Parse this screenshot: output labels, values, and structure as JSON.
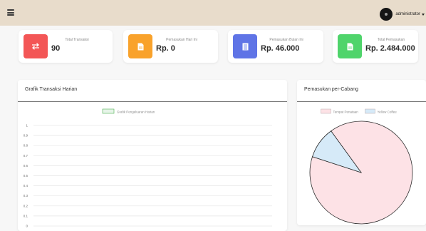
{
  "topbar": {
    "user_name": "administrator"
  },
  "cards": [
    {
      "label": "Total Transaksi",
      "value": "90",
      "icon": "exchange-arrows-icon",
      "color": "#f35656"
    },
    {
      "label": "Pemasukan Hari Ini",
      "value": "Rp. 0",
      "icon": "document-icon",
      "color": "#f9a22b"
    },
    {
      "label": "Pemasukan Bulan Ini",
      "value": "Rp. 46.000",
      "icon": "list-icon",
      "color": "#5f74e6"
    },
    {
      "label": "Total Pemasukan",
      "value": "Rp. 2.484.000",
      "icon": "document-icon",
      "color": "#4fd46b"
    }
  ],
  "panels": {
    "daily": {
      "title": "Grafik Transaksi Harian"
    },
    "branch": {
      "title": "Pemasukan per-Cabang"
    }
  },
  "chart_data": [
    {
      "type": "line",
      "title": "",
      "xlabel": "",
      "ylabel": "",
      "ylim": [
        0,
        1
      ],
      "yticks": [
        "1",
        "0.9",
        "0.8",
        "0.7",
        "0.6",
        "0.5",
        "0.4",
        "0.3",
        "0.2",
        "0.1",
        "0"
      ],
      "grid": true,
      "legend_position": "top",
      "series": [
        {
          "name": "Grafik Pengeluaran Harian",
          "color": "#4caf50",
          "values": []
        }
      ]
    },
    {
      "type": "pie",
      "title": "",
      "legend_position": "top",
      "slices": [
        {
          "label": "Tempat Penataan",
          "value": 90,
          "color": "#fde2e6"
        },
        {
          "label": "Yellow Coffee",
          "value": 10,
          "color": "#d6eaf8"
        }
      ]
    }
  ]
}
